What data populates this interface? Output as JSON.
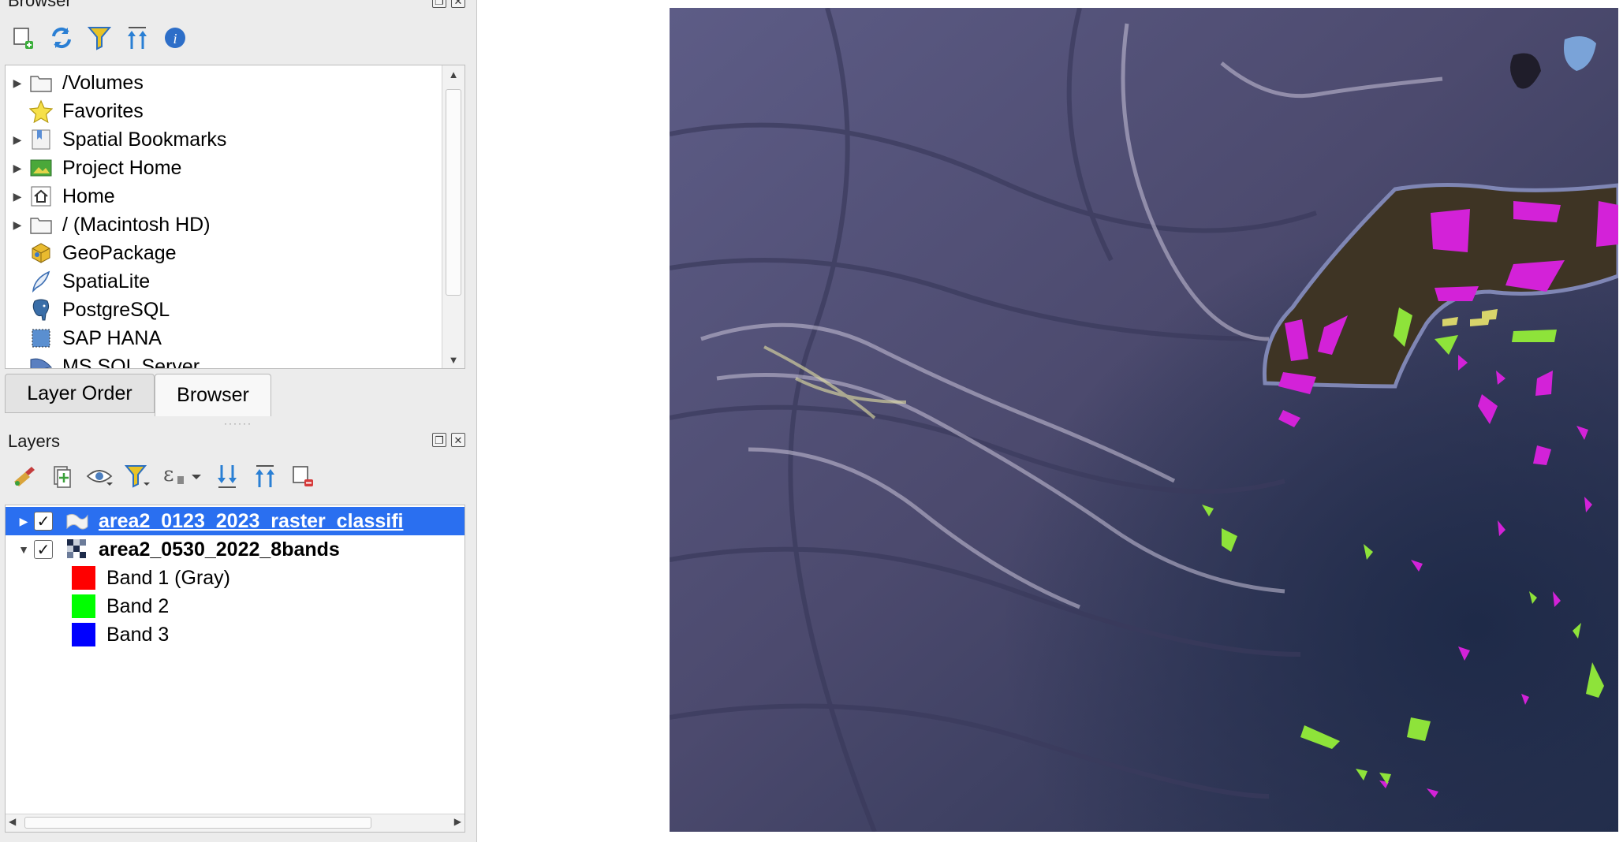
{
  "browser_panel": {
    "title": "Browser",
    "toolbar_icons": [
      "add-layer-icon",
      "refresh-icon",
      "filter-icon",
      "collapse-all-icon",
      "info-icon"
    ],
    "items": [
      {
        "label": "/Volumes",
        "icon": "folder-icon",
        "expandable": true
      },
      {
        "label": "Favorites",
        "icon": "star-icon",
        "expandable": false
      },
      {
        "label": "Spatial Bookmarks",
        "icon": "bookmark-icon",
        "expandable": true
      },
      {
        "label": "Project Home",
        "icon": "project-home-icon",
        "expandable": true
      },
      {
        "label": "Home",
        "icon": "home-icon",
        "expandable": true
      },
      {
        "label": "/ (Macintosh HD)",
        "icon": "folder-icon",
        "expandable": true
      },
      {
        "label": "GeoPackage",
        "icon": "geopackage-icon",
        "expandable": false
      },
      {
        "label": "SpatiaLite",
        "icon": "spatialite-icon",
        "expandable": false
      },
      {
        "label": "PostgreSQL",
        "icon": "postgresql-icon",
        "expandable": false
      },
      {
        "label": "SAP HANA",
        "icon": "sap-hana-icon",
        "expandable": false
      },
      {
        "label": "MS SQL Server",
        "icon": "mssql-icon",
        "expandable": false
      }
    ]
  },
  "tabs": {
    "layer_order": "Layer Order",
    "browser": "Browser",
    "active": "Browser"
  },
  "layers_panel": {
    "title": "Layers",
    "toolbar_icons": [
      "style-icon",
      "add-group-icon",
      "visibility-icon",
      "filter-legend-icon",
      "expression-filter-icon",
      "expand-all-icon",
      "collapse-all-icon",
      "remove-layer-icon"
    ],
    "layers": [
      {
        "name": "area2_0123_2023_raster_classifi",
        "checked": true,
        "selected": true,
        "icon": "polygon-layer-icon"
      },
      {
        "name": "area2_0530_2022_8bands",
        "checked": true,
        "selected": false,
        "icon": "raster-layer-icon",
        "bands": [
          {
            "label": "Band 1 (Gray)",
            "color": "#ff0000"
          },
          {
            "label": "Band 2",
            "color": "#00ff00"
          },
          {
            "label": "Band 3",
            "color": "#0000ff"
          }
        ]
      }
    ]
  },
  "map": {
    "description_colors": {
      "classified_magenta": "#d322d8",
      "classified_green": "#8ee33a",
      "lake": "#3e3424"
    }
  }
}
